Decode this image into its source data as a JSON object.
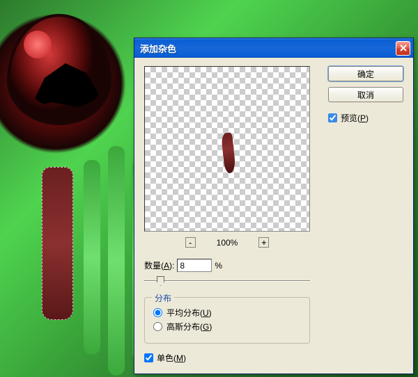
{
  "canvas": {
    "description": "frog-eye-with-green-drips"
  },
  "dialog": {
    "title": "添加杂色",
    "buttons": {
      "ok": "确定",
      "cancel": "取消"
    },
    "preview_checkbox": {
      "label": "预览(P)",
      "checked": true
    },
    "zoom": {
      "level": "100%",
      "minus": "-",
      "plus": "+"
    },
    "amount": {
      "label": "数量(A):",
      "value": "8",
      "unit": "%"
    },
    "distribution": {
      "legend": "分布",
      "options": [
        {
          "label": "平均分布(U)",
          "value": "uniform",
          "checked": true
        },
        {
          "label": "高斯分布(G)",
          "value": "gaussian",
          "checked": false
        }
      ]
    },
    "monochrome": {
      "label": "单色(M)",
      "checked": true
    }
  }
}
